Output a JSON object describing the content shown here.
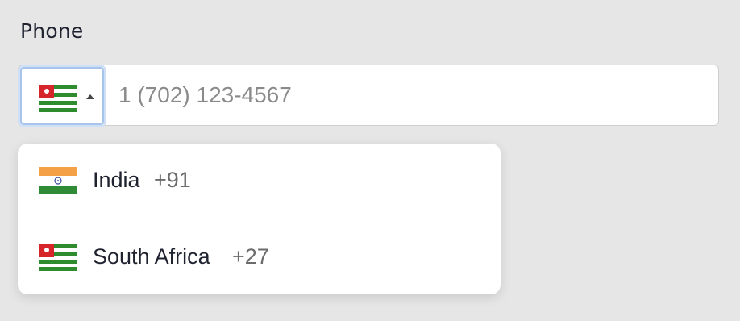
{
  "form": {
    "phone_label": "Phone",
    "phone_placeholder": "1 (702) 123-4567",
    "selected_country_flag": "abkhazia-flag-icon"
  },
  "dropdown": {
    "options": [
      {
        "name": "India",
        "code": "+91",
        "flag_icon": "india-flag-icon"
      },
      {
        "name": "South Africa",
        "code": "+27",
        "flag_icon": "striped-flag-icon"
      }
    ]
  },
  "colors": {
    "background": "#e6e6e6",
    "focus_ring": "#a7c4ea",
    "flag_green": "#2e8b2e",
    "flag_red": "#d6262b",
    "india_saffron": "#f4a046",
    "india_green": "#2f8b35",
    "chakra_blue": "#3a4ea0"
  }
}
